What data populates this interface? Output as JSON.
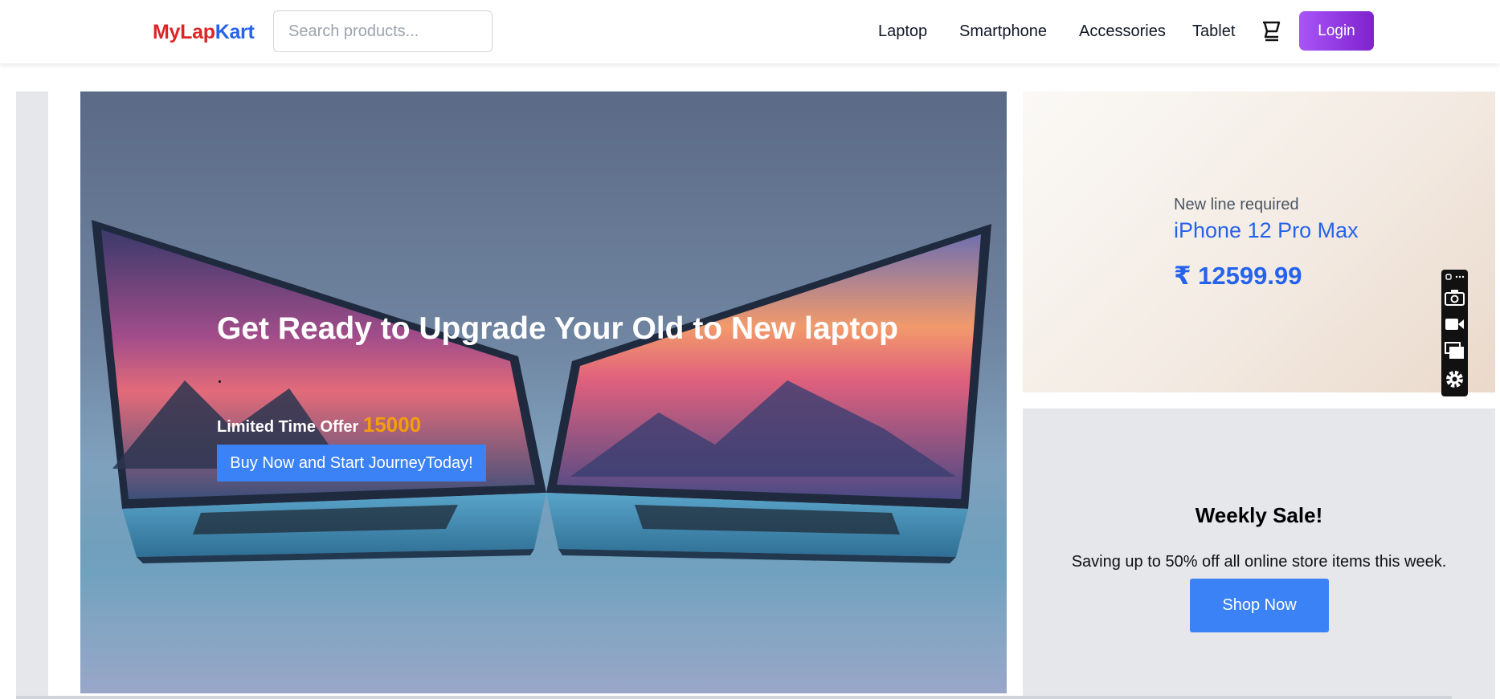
{
  "header": {
    "logo_part1": "MyLap",
    "logo_part2": "Kart",
    "search_placeholder": "Search products...",
    "nav": [
      "Laptop",
      "Smartphone",
      "Accessories",
      "Tablet"
    ],
    "cart_icon": "cart-icon",
    "login_label": "Login"
  },
  "hero": {
    "title": "Get Ready to Upgrade Your Old to New laptop",
    "offer_label": "Limited Time Offer",
    "offer_amount": "15000",
    "cta_label": "Buy Now and Start JourneyToday!"
  },
  "promo": {
    "subtitle": "New line required",
    "title": "iPhone 12 Pro Max",
    "price": "₹ 12599.99"
  },
  "weekly": {
    "title": "Weekly Sale!",
    "text": "Saving up to 50% off all online store items this week.",
    "cta_label": "Shop Now"
  },
  "toolbar": {
    "icons": [
      "link-icon",
      "more-icon",
      "camera-icon",
      "video-icon",
      "screens-icon",
      "gear-icon"
    ]
  },
  "colors": {
    "brand_red": "#dc2626",
    "brand_blue": "#2563eb",
    "login_gradient_start": "#a855f7",
    "login_gradient_end": "#7e22ce",
    "button_blue": "#3b82f6",
    "offer_amount": "#f59e0b"
  }
}
